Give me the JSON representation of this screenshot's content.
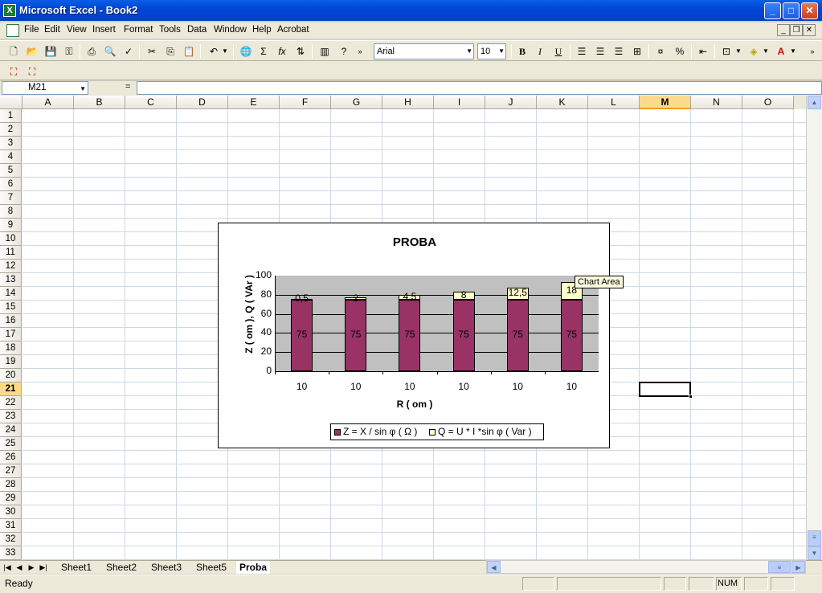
{
  "window": {
    "title": "Microsoft Excel - Book2",
    "minimize": "_",
    "maximize": "□",
    "close": "✕"
  },
  "menu": [
    "File",
    "Edit",
    "View",
    "Insert",
    "Format",
    "Tools",
    "Data",
    "Window",
    "Help",
    "Acrobat"
  ],
  "toolbar": {
    "font_name": "Arial",
    "font_size": "10",
    "bold": "B",
    "italic": "I",
    "underline": "U",
    "sigma": "Σ",
    "fx": "fx",
    "percent": "%"
  },
  "formula_bar": {
    "name_box": "M21",
    "equals": "=",
    "value": ""
  },
  "columns": [
    "A",
    "B",
    "C",
    "D",
    "E",
    "F",
    "G",
    "H",
    "I",
    "J",
    "K",
    "L",
    "M",
    "N",
    "O"
  ],
  "selected_column": "M",
  "rows": [
    "1",
    "2",
    "3",
    "4",
    "5",
    "6",
    "7",
    "8",
    "9",
    "10",
    "11",
    "12",
    "13",
    "14",
    "15",
    "16",
    "17",
    "18",
    "19",
    "20",
    "21",
    "22",
    "23",
    "24",
    "25",
    "26",
    "27",
    "28",
    "29",
    "30",
    "31",
    "32",
    "33"
  ],
  "selected_row": "21",
  "sheets": [
    "Sheet1",
    "Sheet2",
    "Sheet3",
    "Sheet5",
    "Proba"
  ],
  "active_sheet": "Proba",
  "status": {
    "ready": "Ready",
    "num": "NUM"
  },
  "tooltip": "Chart Area",
  "colors": {
    "series_z": "#993366",
    "series_q": "#ffffcc",
    "plot_bg": "#c0c0c0"
  },
  "chart_data": {
    "type": "bar",
    "stacked": true,
    "title": "PROBA",
    "xlabel": "R ( om )",
    "ylabel": "Z ( om ), Q ( VAr )",
    "ylim": [
      0,
      100
    ],
    "yticks": [
      "0",
      "20",
      "40",
      "60",
      "80",
      "100"
    ],
    "categories": [
      "10",
      "10",
      "10",
      "10",
      "10",
      "10"
    ],
    "series": [
      {
        "name": "Z = X / sin φ ( Ω )",
        "values": [
          75,
          75,
          75,
          75,
          75,
          75
        ],
        "labels": [
          "75",
          "75",
          "75",
          "75",
          "75",
          "75"
        ]
      },
      {
        "name": "Q = U * I *sin φ ( Var )",
        "values": [
          0.5,
          2,
          4.5,
          8,
          12.5,
          18
        ],
        "labels": [
          "0,5",
          "2",
          "4,5",
          "8",
          "12,5",
          "18"
        ]
      }
    ],
    "legend_position": "bottom",
    "grid": true
  }
}
